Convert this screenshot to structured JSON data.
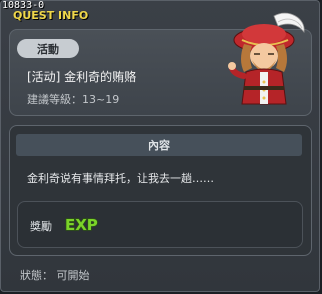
{
  "window": {
    "quest_id": "10833-0",
    "title": "QUEST INFO"
  },
  "quest": {
    "category": "活動",
    "name": "[活动] 金利奇的贿赂",
    "level": "建議等級：13~19"
  },
  "content": {
    "header": "內容",
    "description": "金利奇说有事情拜托，让我去一趟……"
  },
  "reward": {
    "label": "獎勵",
    "exp_text": "EXP"
  },
  "status": {
    "text": "狀態： 可開始"
  },
  "colors": {
    "title_yellow": "#f0d84a",
    "exp_green": "#7bd32a"
  }
}
